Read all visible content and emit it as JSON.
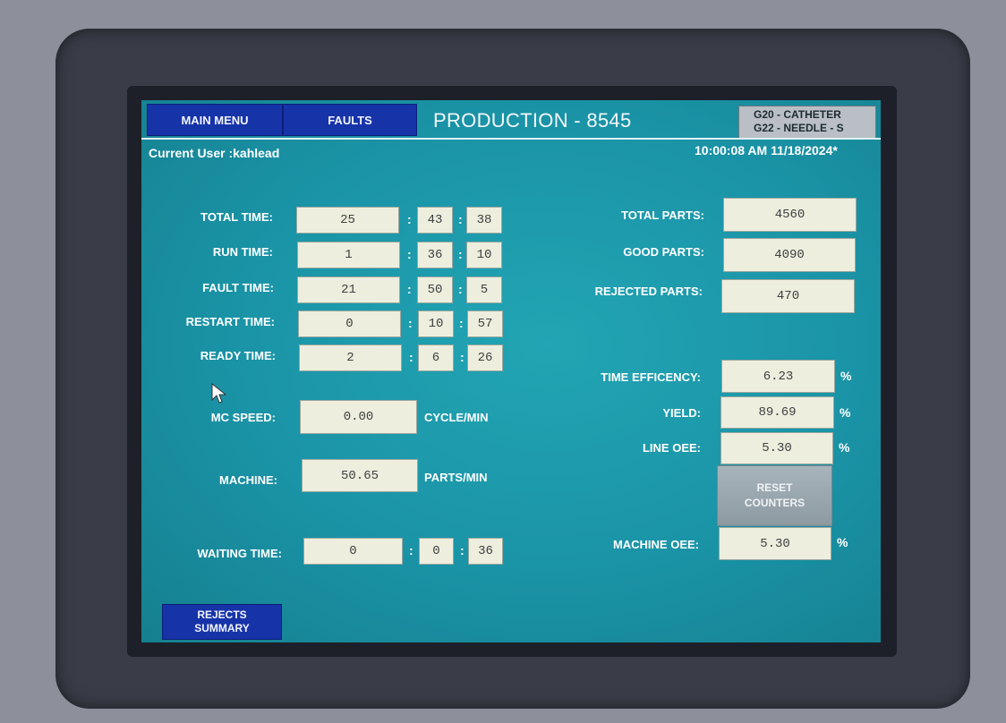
{
  "header": {
    "main_menu": "MAIN MENU",
    "faults": "FAULTS",
    "title": "PRODUCTION - 8545",
    "products": [
      "G20 - CATHETER",
      "G22 - NEEDLE - S"
    ]
  },
  "status": {
    "current_user": "Current User :kahlead",
    "datetime": "10:00:08 AM 11/18/2024*"
  },
  "times": [
    {
      "label": "TOTAL TIME:",
      "h": "25",
      "m": "43",
      "s": "38"
    },
    {
      "label": "RUN TIME:",
      "h": "1",
      "m": "36",
      "s": "10"
    },
    {
      "label": "FAULT TIME:",
      "h": "21",
      "m": "50",
      "s": "5"
    },
    {
      "label": "RESTART TIME:",
      "h": "0",
      "m": "10",
      "s": "57"
    },
    {
      "label": "READY TIME:",
      "h": "2",
      "m": "6",
      "s": "26"
    }
  ],
  "speed": {
    "mc_speed_label": "MC SPEED:",
    "mc_speed_value": "0.00",
    "mc_speed_unit": "CYCLE/MIN",
    "machine_label": "MACHINE:",
    "machine_value": "50.65",
    "machine_unit": "PARTS/MIN"
  },
  "waiting": {
    "label": "WAITING TIME:",
    "h": "0",
    "m": "0",
    "s": "36"
  },
  "parts": [
    {
      "label": "TOTAL PARTS:",
      "value": "4560"
    },
    {
      "label": "GOOD PARTS:",
      "value": "4090"
    },
    {
      "label": "REJECTED PARTS:",
      "value": "470"
    }
  ],
  "metrics": [
    {
      "label": "TIME EFFICENCY:",
      "value": "6.23",
      "unit": "%"
    },
    {
      "label": "YIELD:",
      "value": "89.69",
      "unit": "%"
    },
    {
      "label": "LINE OEE:",
      "value": "5.30",
      "unit": "%"
    }
  ],
  "reset": {
    "line1": "RESET",
    "line2": "COUNTERS"
  },
  "machine_oee": {
    "label": "MACHINE OEE:",
    "value": "5.30",
    "unit": "%"
  },
  "rejects_summary": {
    "line1": "REJECTS",
    "line2": "SUMMARY"
  },
  "colon": ":",
  "icons": {
    "cursor": "mouse-pointer-icon"
  },
  "colors": {
    "screen": "#1a93a6",
    "nav_button": "#1633a8",
    "field_bg": "#eeeede"
  }
}
